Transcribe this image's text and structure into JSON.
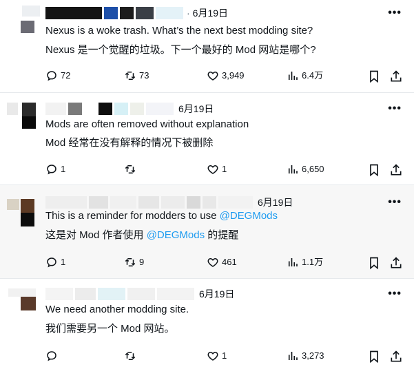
{
  "date_separator": "·",
  "more_glyph": "•••",
  "tweets": [
    {
      "date": "6月19日",
      "line1": "Nexus is a woke trash. What’s the next best modding site?",
      "line2": "Nexus 是一个觉醒的垃圾。下一个最好的 Mod 网站是哪个?",
      "replies": "72",
      "retweets": "73",
      "likes": "3,949",
      "views": "6.4万"
    },
    {
      "date": "6月19日",
      "line1": "Mods are often removed without explanation",
      "line2": "Mod 经常在没有解释的情况下被删除",
      "replies": "1",
      "retweets": "",
      "likes": "1",
      "views": "6,650"
    },
    {
      "date": "6月19日",
      "line1_prefix": "This is a reminder for modders to use ",
      "line1_mention": "@DEGMods",
      "line2_prefix": "这是对 Mod 作者使用 ",
      "line2_mention": "@DEGMods",
      "line2_suffix": " 的提醒",
      "replies": "1",
      "retweets": "9",
      "likes": "461",
      "views": "1.1万"
    },
    {
      "date": "6月19日",
      "line1": "We need another modding site.",
      "line2": "我们需要另一个 Mod 网站。",
      "replies": "",
      "retweets": "",
      "likes": "1",
      "views": "3,273"
    }
  ],
  "icons": [
    "reply-icon",
    "retweet-icon",
    "like-icon",
    "views-icon",
    "bookmark-icon",
    "share-icon",
    "more-icon"
  ],
  "colors": {
    "text": "#0f1419",
    "secondary": "#536471",
    "mention": "#1d9bf0",
    "divider": "#e6e9ec",
    "highlight_bg": "#f7f7f7"
  }
}
